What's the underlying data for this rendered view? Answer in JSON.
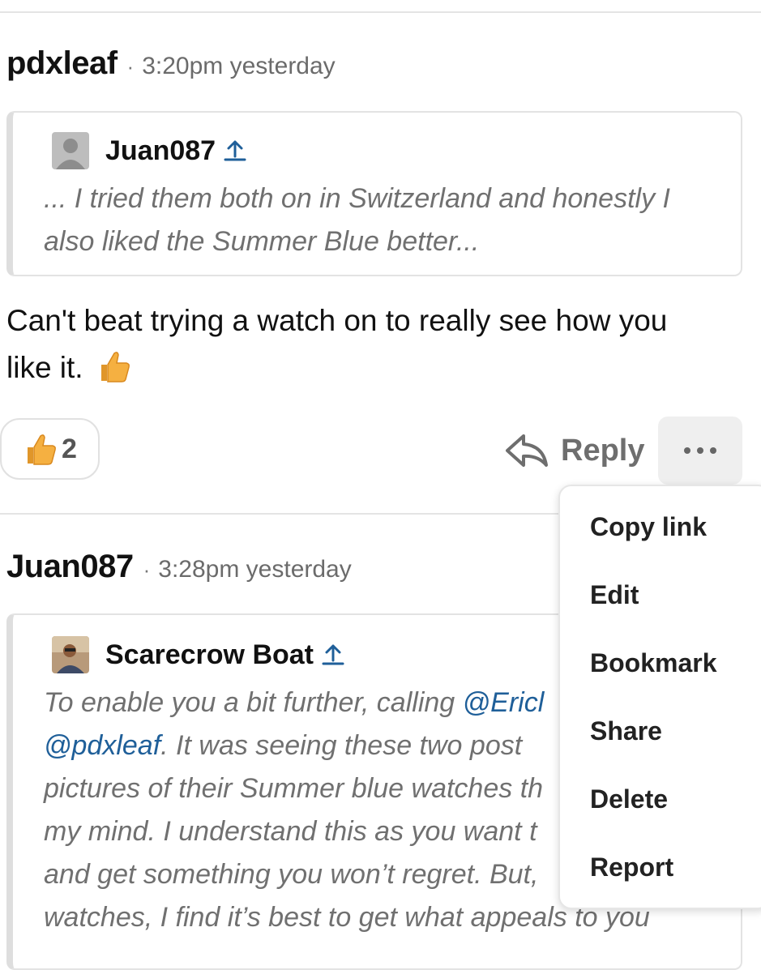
{
  "post1": {
    "author": "pdxleaf",
    "separator": "·",
    "time": "3:20pm yesterday",
    "quote": {
      "author": "Juan087",
      "text": "... I tried them both on in Switzerland and honestly I also liked the Summer Blue better..."
    },
    "body_line1": "Can't beat trying a watch on to really see how you",
    "body_line2": "like it.",
    "like_count": "2",
    "reply_label": "Reply"
  },
  "post2": {
    "author": "Juan087",
    "separator": "·",
    "time": "3:28pm yesterday",
    "quote": {
      "author": "Scarecrow Boat",
      "line1_prefix": "To enable you a bit further, calling ",
      "mention1": "@Ericl",
      "mention2": "@pdxleaf",
      "line2_suffix": ". It was seeing these two post",
      "line3": "pictures of their Summer blue watches th",
      "line4": "my mind. I understand this as you want t",
      "line5": "and get something you won’t regret. But,",
      "line6": "watches, I find it’s best to get what appeals to you"
    }
  },
  "menu": {
    "items": [
      "Copy link",
      "Edit",
      "Bookmark",
      "Share",
      "Delete",
      "Report"
    ]
  },
  "icons": {
    "thumbs_up": "thumbs-up-icon",
    "reply": "reply-arrow-icon",
    "more": "more-dots-icon",
    "author_marker": "up-arrow-icon"
  },
  "colors": {
    "accent": "#1f5f99",
    "thumb": "#f5b041"
  }
}
